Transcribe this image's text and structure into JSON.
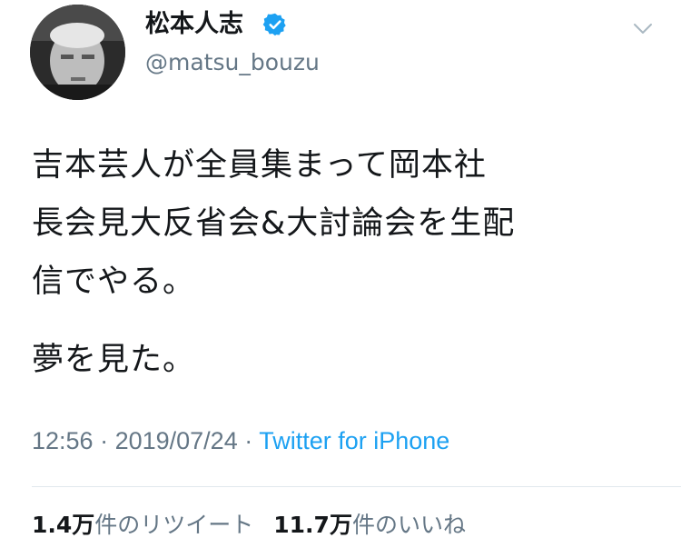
{
  "author": {
    "display_name": "松本人志",
    "handle": "@matsu_bouzu",
    "verified": true
  },
  "icons": {
    "verified": "verified-badge-icon",
    "menu": "chevron-down-icon"
  },
  "tweet": {
    "lines": [
      "吉本芸人が全員集まって岡本社",
      "長会見大反省会&大討論会を生配",
      "信でやる。",
      "夢を見た。"
    ]
  },
  "meta": {
    "time": "12:56",
    "separator1": " · ",
    "date": "2019/07/24",
    "separator2": " · ",
    "source": "Twitter for iPhone"
  },
  "stats": {
    "retweets_count": "1.4万",
    "retweets_label": "件のリツイート",
    "likes_count": "11.7万",
    "likes_label": "件のいいね"
  },
  "colors": {
    "text": "#14171a",
    "secondary": "#657786",
    "link": "#1da1f2",
    "verified": "#1da1f2",
    "divider": "#e1e8ed"
  }
}
